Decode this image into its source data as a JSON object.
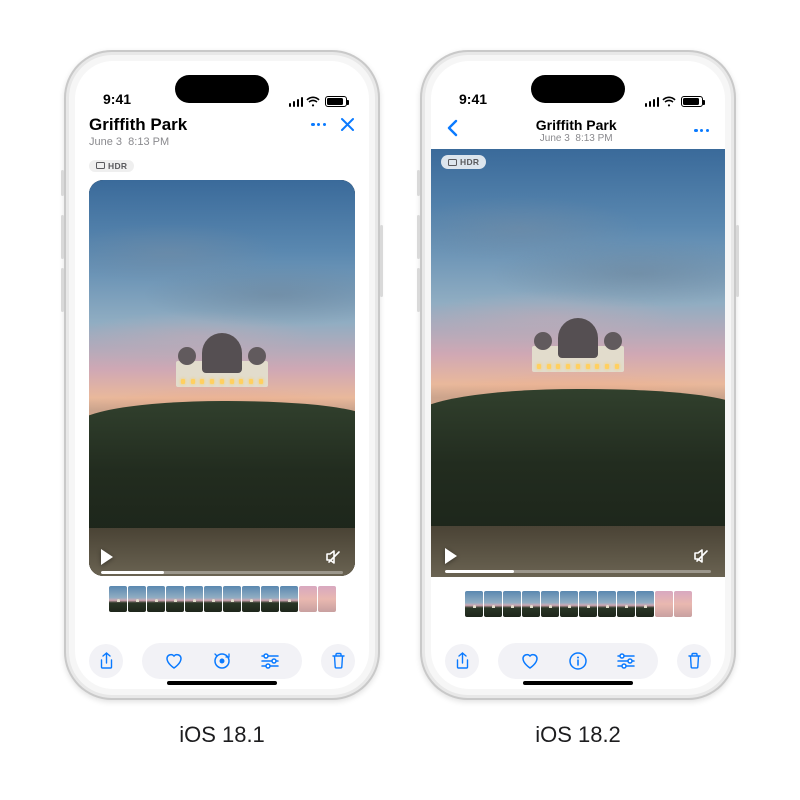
{
  "status": {
    "time": "9:41"
  },
  "photo": {
    "title": "Griffith Park",
    "date": "June 3",
    "time": "8:13 PM",
    "hdr_label": "HDR"
  },
  "playback": {
    "progress_pct": 26
  },
  "captions": {
    "left": "iOS 18.1",
    "right": "iOS 18.2"
  },
  "thumbs": 12,
  "colors": {
    "accent": "#0a7aff"
  }
}
